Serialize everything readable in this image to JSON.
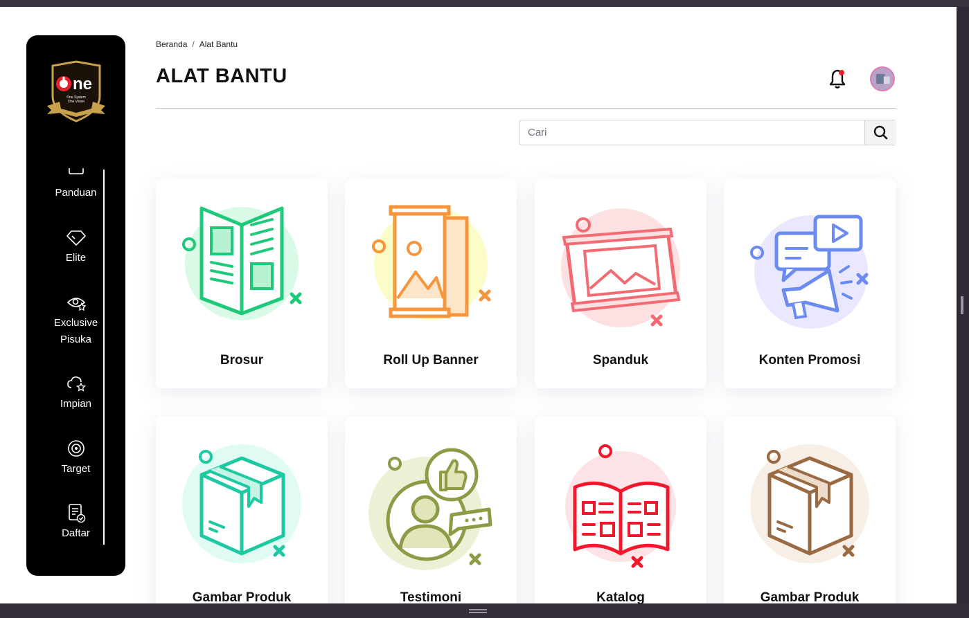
{
  "window": {
    "title": "Alat Bantu"
  },
  "sidebar": {
    "logo_alt": "One System One Vision - Highway to Success",
    "items": [
      {
        "label": "Panduan",
        "icon": "book-icon"
      },
      {
        "label": "Elite",
        "icon": "diamond-icon"
      },
      {
        "label": "Exclusive Pisuka",
        "icon": "eye-star-icon"
      },
      {
        "label": "Impian",
        "icon": "cloud-star-icon"
      },
      {
        "label": "Target",
        "icon": "target-icon"
      },
      {
        "label": "Daftar",
        "icon": "checklist-icon"
      }
    ]
  },
  "breadcrumb": {
    "home": "Beranda",
    "separator": "/",
    "current": "Alat Bantu"
  },
  "header": {
    "title": "ALAT BANTU",
    "notification_dot_color": "#e8202a"
  },
  "search": {
    "placeholder": "Cari",
    "value": ""
  },
  "cards": [
    {
      "label": "Brosur",
      "icon": "brochure-icon",
      "color": "#1ec97a"
    },
    {
      "label": "Roll Up Banner",
      "icon": "rollup-banner-icon",
      "color": "#f7953d"
    },
    {
      "label": "Spanduk",
      "icon": "banner-icon",
      "color": "#f26a72"
    },
    {
      "label": "Konten Promosi",
      "icon": "promo-content-icon",
      "color": "#6b8bf0"
    },
    {
      "label": "Gambar Produk",
      "icon": "box-icon",
      "color": "#1cc9a0"
    },
    {
      "label": "Testimoni",
      "icon": "testimonial-icon",
      "color": "#8f9a47"
    },
    {
      "label": "Katalog",
      "icon": "catalog-icon",
      "color": "#f0182a"
    },
    {
      "label": "Gambar Produk",
      "icon": "box-icon",
      "color": "#9a6a43"
    }
  ]
}
